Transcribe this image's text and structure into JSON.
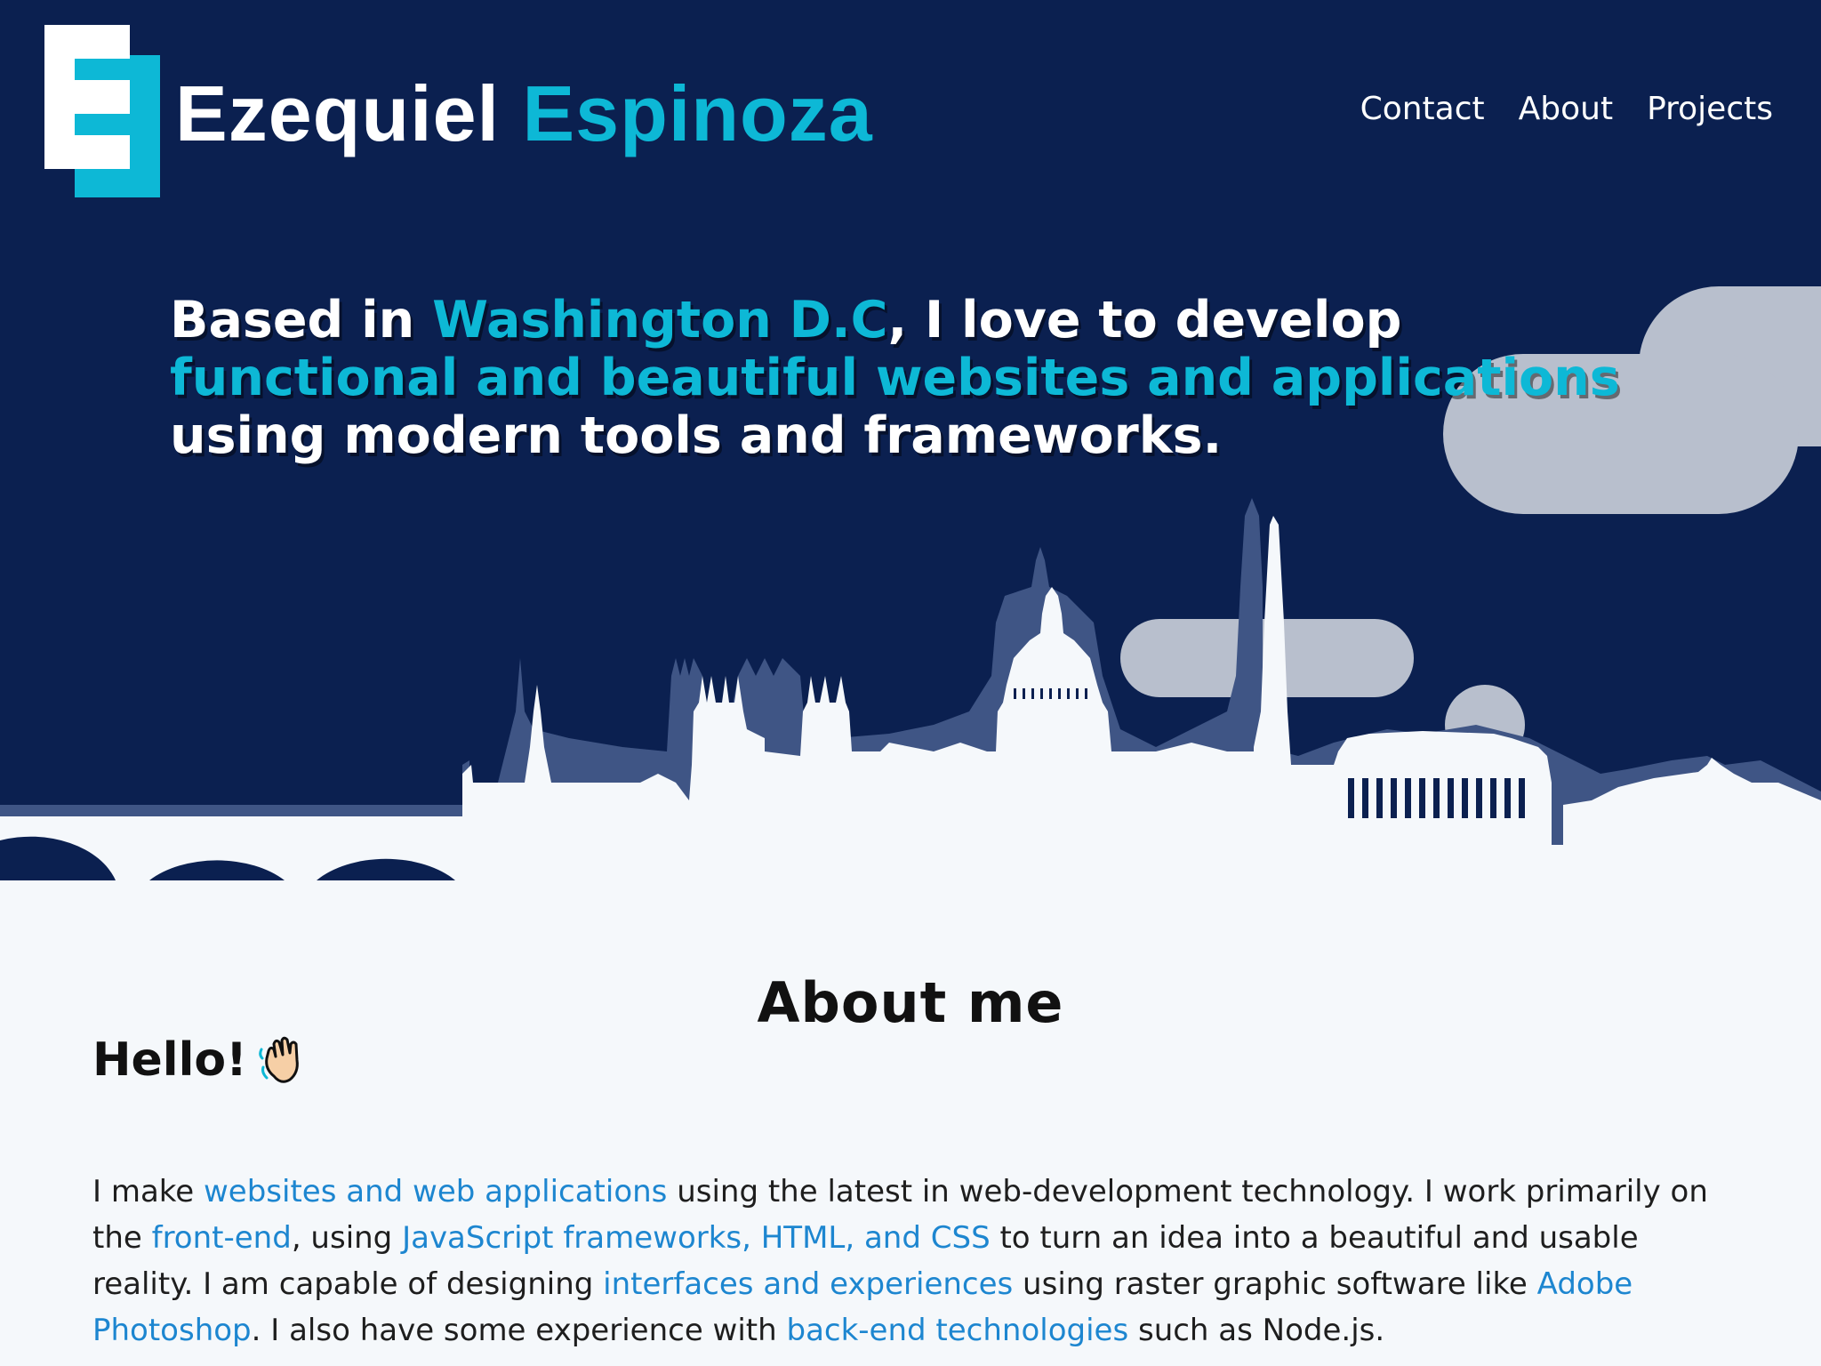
{
  "brand": {
    "first": "Ezequiel",
    "last": "Espinoza",
    "logo_letter": "E"
  },
  "nav": {
    "items": [
      "Contact",
      "About",
      "Projects"
    ]
  },
  "hero": {
    "tagline": {
      "t1": "Based in ",
      "h1": "Washington D.C",
      "t2": ", I love to develop ",
      "h2": "functional and beautiful websites and applications",
      "t3": " using modern tools and frameworks."
    }
  },
  "about": {
    "title": "About me",
    "hello": "Hello!",
    "hello_icon": "waving-hand-icon",
    "paragraph": {
      "p1": "I make ",
      "l1": "websites and web applications",
      "p2": " using the latest in web-development technology. I work primarily on the ",
      "l2": "front-end",
      "p3": ", using ",
      "l3": "JavaScript frameworks, HTML, and CSS",
      "p4": " to turn an idea into a beautiful and usable reality. I am capable of designing ",
      "l4": "interfaces and experiences",
      "p5": " using raster graphic software like ",
      "l5": "Adobe Photoshop",
      "p6": ". I also have some experience with ",
      "l6": "back-end technologies",
      "p7": " such as Node.js."
    }
  },
  "colors": {
    "hero_bg": "#0b2050",
    "accent": "#0db8d6",
    "link": "#1d86d0",
    "page_bg": "#f5f8fb",
    "skyline_back": "#3f5585",
    "skyline_front": "#f5f8fb",
    "cloud": "#b8bfcd"
  }
}
